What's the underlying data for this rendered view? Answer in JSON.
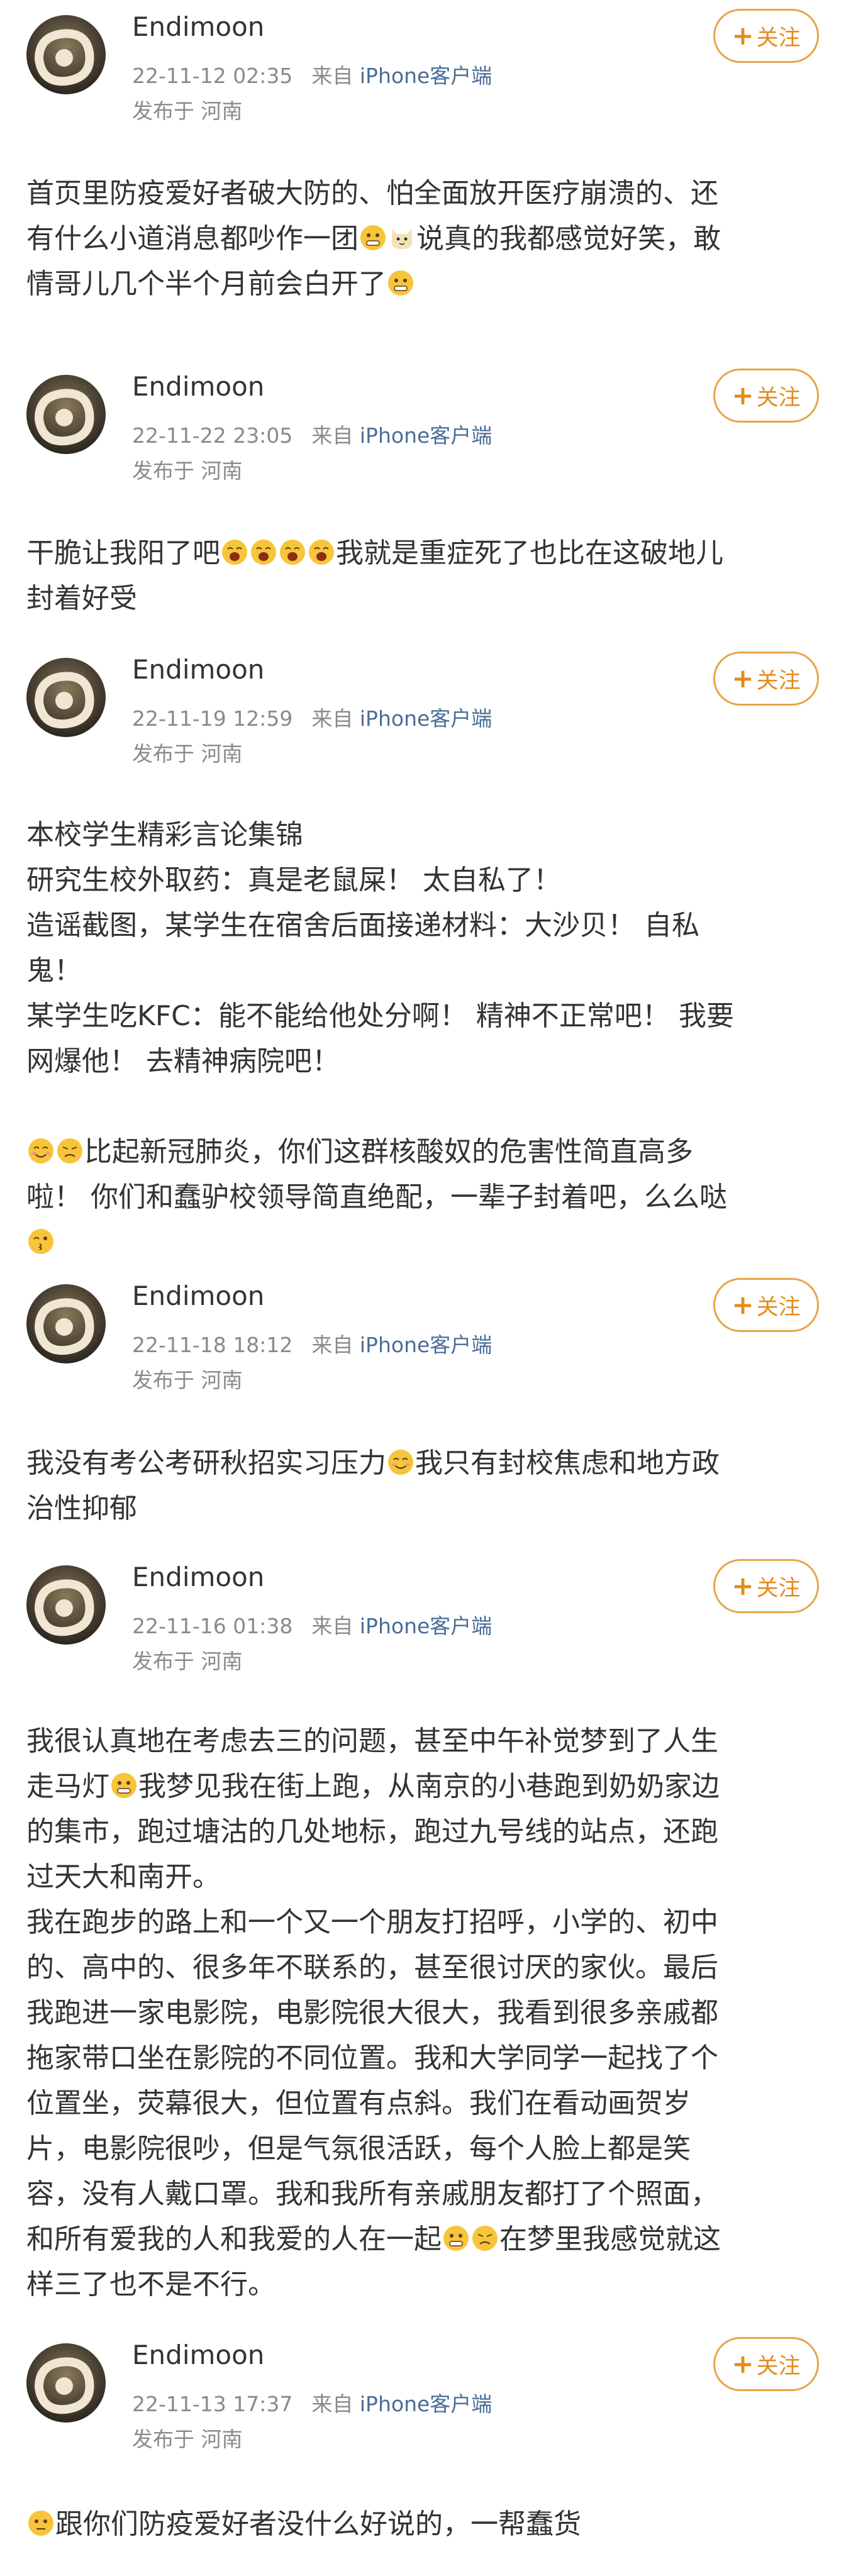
{
  "common": {
    "username": "Endimoon",
    "source_prefix": "来自",
    "client": "iPhone客户端",
    "location": "发布于 河南",
    "follow_label": "关注",
    "follow_plus": "+"
  },
  "posts": [
    {
      "time": "22-11-12 02:35",
      "segments": [
        "首页里防疫爱好者破大防的、怕全面放开医疗崩溃的、还",
        "有什么小道消息都吵作一团",
        "说真的我都感觉好笑，敢",
        "情哥儿几个半个月前会白开了"
      ]
    },
    {
      "time": "22-11-22 23:05",
      "segments": [
        "干脆让我阳了吧",
        "我就是重症死了也比在这破地儿",
        "封着好受"
      ]
    },
    {
      "time": "22-11-19 12:59",
      "segments": [
        "本校学生精彩言论集锦",
        "研究生校外取药：真是老鼠屎！ 太自私了！",
        "造谣截图，某学生在宿舍后面接递材料：大沙贝！ 自私",
        "鬼！",
        "某学生吃KFC：能不能给他处分啊！ 精神不正常吧！ 我要",
        "网爆他！ 去精神病院吧！",
        "比起新冠肺炎，你们这群核酸奴的危害性简直高多",
        "啦！ 你们和蠢驴校领导简直绝配，一辈子封着吧，么么哒"
      ]
    },
    {
      "time": "22-11-18 18:12",
      "segments": [
        "我没有考公考研秋招实习压力",
        "我只有封校焦虑和地方政",
        "治性抑郁"
      ]
    },
    {
      "time": "22-11-16 01:38",
      "segments": [
        "我很认真地在考虑去三的问题，甚至中午补觉梦到了人生",
        "走马灯",
        "我梦见我在街上跑，从南京的小巷跑到奶奶家边",
        "的集市，跑过塘沽的几处地标，跑过九号线的站点，还跑",
        "过天大和南开。",
        "我在跑步的路上和一个又一个朋友打招呼，小学的、初中",
        "的、高中的、很多年不联系的，甚至很讨厌的家伙。最后",
        "我跑进一家电影院，电影院很大很大，我看到很多亲戚都",
        "拖家带口坐在影院的不同位置。我和大学同学一起找了个",
        "位置坐，荧幕很大，但位置有点斜。我们在看动画贺岁",
        "片，电影院很吵，但是气氛很活跃，每个人脸上都是笑",
        "容，没有人戴口罩。我和我所有亲戚朋友都打了个照面，",
        "和所有爱我的人和我爱的人在一起",
        "在梦里我感觉就这",
        "样三了也不是不行。"
      ]
    },
    {
      "time": "22-11-13 17:37",
      "segments": [
        "跟你们防疫爱好者没什么好说的，一帮蠢货"
      ]
    }
  ],
  "emoji_names": {
    "grin": "awkward-grin-emoji",
    "cat": "cat-emoji",
    "yawn": "yawn-emoji",
    "smile": "smile-emoji",
    "disappointed": "disappointed-emoji",
    "kiss": "kiss-emoji",
    "blank": "blank-stare-emoji"
  },
  "colors": {
    "text": "#333333",
    "meta": "#8a8a8a",
    "client_link": "#4a6d97",
    "follow_border": "#e8a44a",
    "follow_text": "#e58b1b",
    "emoji_yellow": "#f7c43a"
  }
}
